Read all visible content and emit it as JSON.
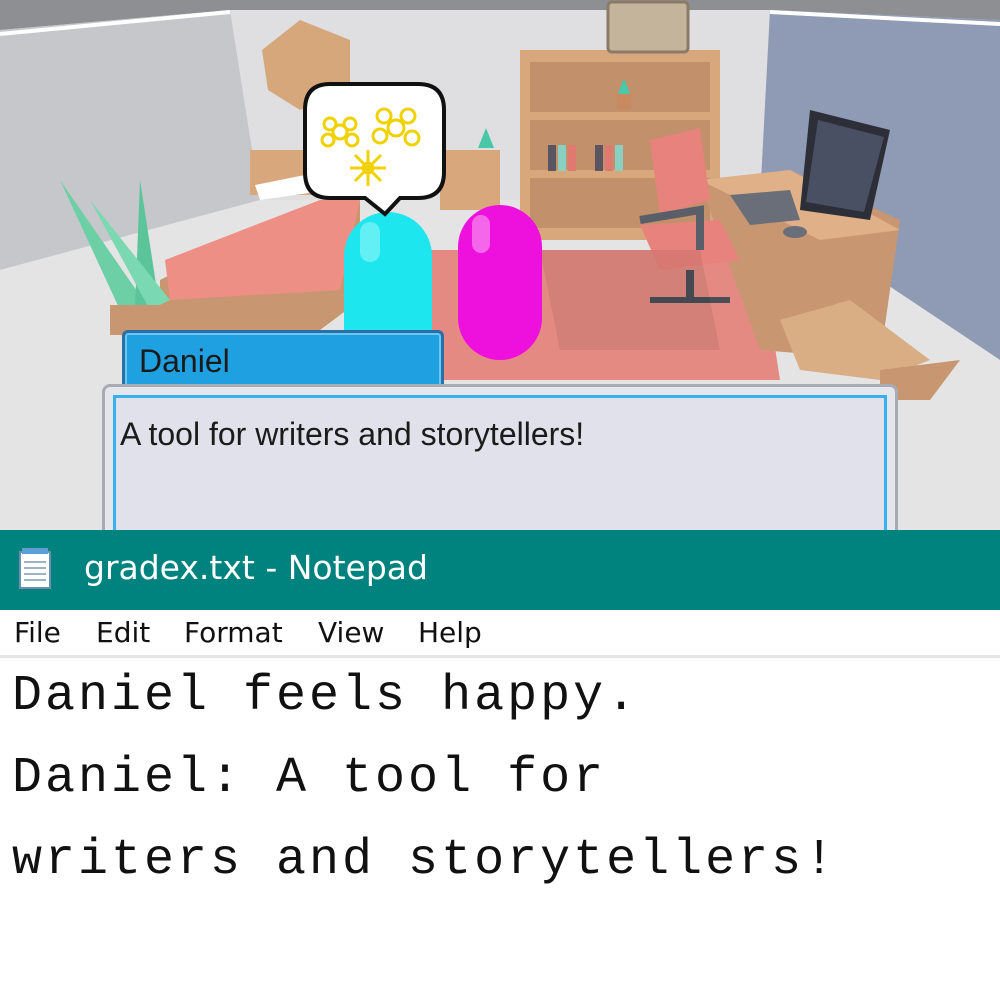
{
  "scene": {
    "speaker_name": "Daniel",
    "dialog_text": "A tool for writers and storytellers!",
    "thought_bubble_icon": "flowers-icon"
  },
  "notepad": {
    "icon": "notepad-icon",
    "title": "gradex.txt - Notepad",
    "menu": [
      "File",
      "Edit",
      "Format",
      "View",
      "Help"
    ],
    "lines": [
      "Daniel feels happy.",
      "Daniel: A tool for",
      "writers and storytellers!"
    ]
  },
  "colors": {
    "titlebar": "#00827f",
    "name_box": "#1fa0e0",
    "dialog_border": "#36b0ef",
    "cyan_character": "#1ee6ee",
    "magenta_character": "#ee10dc"
  }
}
